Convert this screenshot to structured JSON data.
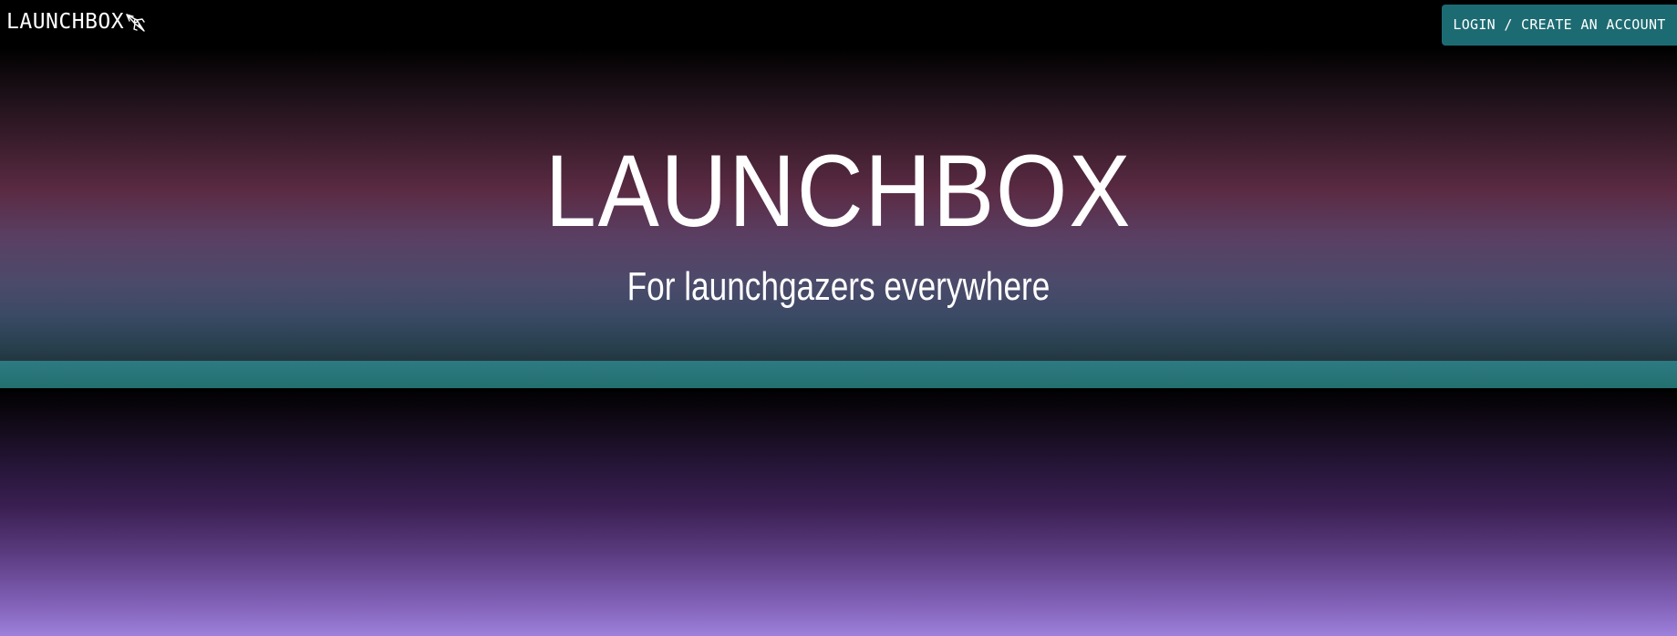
{
  "header": {
    "brand_name": "LAUNCHBOX",
    "brand_icon": "rocket-icon",
    "login_label": "LOGIN / CREATE AN ACCOUNT"
  },
  "hero": {
    "title": "LAUNCHBOX",
    "subtitle": "For launchgazers everywhere"
  },
  "colors": {
    "accent_teal": "#1d6b72",
    "band_teal": "#2a7479",
    "hero_mauve": "#5b2b44",
    "lower_violet": "#9d80dc"
  }
}
